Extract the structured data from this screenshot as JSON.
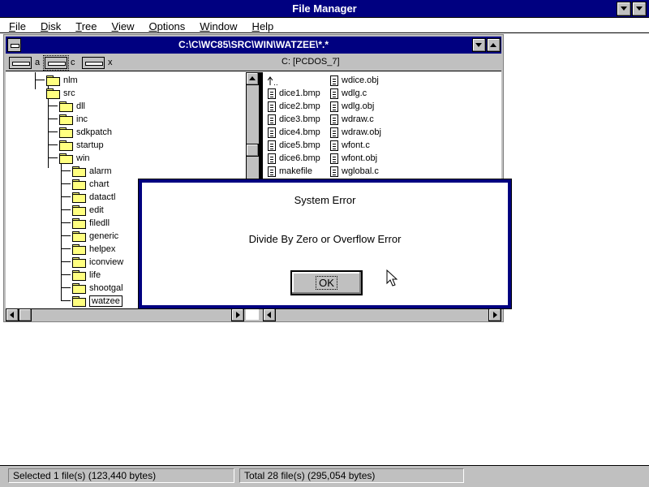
{
  "app": {
    "title": "File Manager",
    "menu": [
      "File",
      "Disk",
      "Tree",
      "View",
      "Options",
      "Window",
      "Help"
    ]
  },
  "child": {
    "title": "C:\\C\\WC85\\SRC\\WIN\\WATZEE\\*.*",
    "drives": [
      {
        "letter": "a",
        "selected": false
      },
      {
        "letter": "c",
        "selected": true
      },
      {
        "letter": "x",
        "selected": false
      }
    ],
    "volume_label": "C: [PCDOS_7]"
  },
  "tree": {
    "items": [
      {
        "label": "nlm",
        "level": 1
      },
      {
        "label": "src",
        "level": 1
      },
      {
        "label": "dll",
        "level": 2
      },
      {
        "label": "inc",
        "level": 2
      },
      {
        "label": "sdkpatch",
        "level": 2
      },
      {
        "label": "startup",
        "level": 2
      },
      {
        "label": "win",
        "level": 2
      },
      {
        "label": "alarm",
        "level": 3
      },
      {
        "label": "chart",
        "level": 3
      },
      {
        "label": "datactl",
        "level": 3
      },
      {
        "label": "edit",
        "level": 3
      },
      {
        "label": "filedll",
        "level": 3
      },
      {
        "label": "generic",
        "level": 3
      },
      {
        "label": "helpex",
        "level": 3
      },
      {
        "label": "iconview",
        "level": 3
      },
      {
        "label": "life",
        "level": 3
      },
      {
        "label": "shootgal",
        "level": 3
      },
      {
        "label": "watzee",
        "level": 3
      }
    ],
    "selected": "watzee"
  },
  "files": {
    "col1": [
      "..",
      "dice1.bmp",
      "dice2.bmp",
      "dice3.bmp",
      "dice4.bmp",
      "dice5.bmp",
      "dice6.bmp",
      "makefile"
    ],
    "col2": [
      "wdice.obj",
      "wdlg.c",
      "wdlg.obj",
      "wdraw.c",
      "wdraw.obj",
      "wfont.c",
      "wfont.obj",
      "wglobal.c"
    ]
  },
  "dialog": {
    "title": "System Error",
    "message": "Divide By Zero or Overflow Error",
    "ok_label": "OK"
  },
  "status": {
    "selected": "Selected 1 file(s) (123,440 bytes)",
    "total": "Total 28 file(s) (295,054 bytes)"
  }
}
